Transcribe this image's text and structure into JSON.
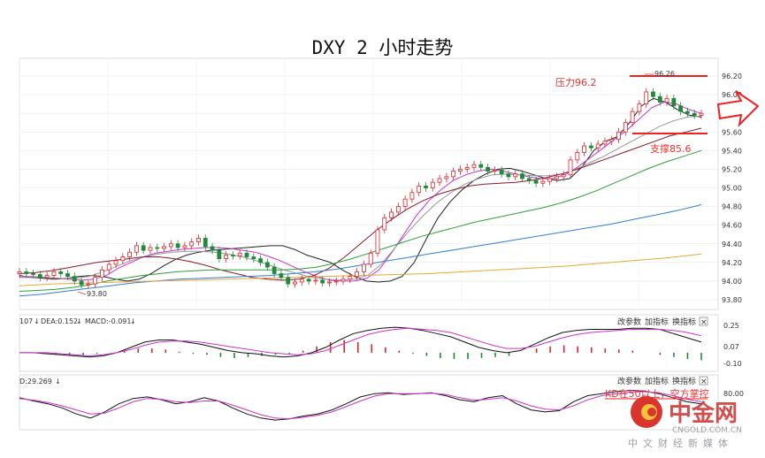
{
  "page": {
    "title": "DXY 2 小时走势"
  },
  "chart_data": [
    {
      "type": "candlestick",
      "title": "DXY 2 小时走势",
      "ylim": [
        93.8,
        96.2
      ],
      "yticks": [
        93.8,
        94.0,
        94.2,
        94.4,
        94.6,
        94.8,
        95.0,
        95.2,
        95.4,
        95.6,
        95.8,
        96.0,
        96.2
      ],
      "ytick_labels": [
        "93.80",
        "94.00",
        "94.20",
        "94.40",
        "94.60",
        "94.80",
        "95.00",
        "95.20",
        "95.40",
        "95.60",
        "95.80",
        "96.00",
        "96.20"
      ],
      "grid": true,
      "closes": [
        94.1,
        94.08,
        94.07,
        94.04,
        94.06,
        94.1,
        94.08,
        94.05,
        94.0,
        93.96,
        93.97,
        94.04,
        94.12,
        94.18,
        94.22,
        94.26,
        94.31,
        94.38,
        94.33,
        94.36,
        94.35,
        94.37,
        94.4,
        94.36,
        94.38,
        94.42,
        94.46,
        94.37,
        94.33,
        94.24,
        94.28,
        94.27,
        94.3,
        94.26,
        94.24,
        94.2,
        94.15,
        94.08,
        94.04,
        93.97,
        93.99,
        94.02,
        94.0,
        94.01,
        93.98,
        93.99,
        94.0,
        94.02,
        94.05,
        94.1,
        94.18,
        94.3,
        94.55,
        94.68,
        94.74,
        94.8,
        94.88,
        94.95,
        95.02,
        95.0,
        95.06,
        95.1,
        95.12,
        95.18,
        95.2,
        95.22,
        95.25,
        95.22,
        95.18,
        95.19,
        95.15,
        95.12,
        95.15,
        95.1,
        95.08,
        95.05,
        95.07,
        95.1,
        95.12,
        95.14,
        95.3,
        95.38,
        95.45,
        95.43,
        95.47,
        95.5,
        95.52,
        95.6,
        95.7,
        95.82,
        95.9,
        96.03,
        95.98,
        95.92,
        95.96,
        95.88,
        95.82,
        95.8,
        95.78,
        95.8
      ],
      "price_annotations": [
        {
          "label": "93.80",
          "value": 93.8
        },
        {
          "label": "96.26",
          "value": 96.26
        }
      ],
      "moving_averages": [
        {
          "color": "#222222",
          "values": [
            94.06,
            94.04,
            94.03,
            94.02,
            94.03,
            94.05,
            94.06,
            94.05,
            94.02,
            94.0,
            94.02,
            94.08,
            94.16,
            94.23,
            94.28,
            94.31,
            94.33,
            94.34,
            94.35,
            94.36,
            94.37,
            94.38,
            94.38,
            94.34,
            94.28,
            94.24,
            94.2,
            94.12,
            94.05,
            94.0,
            93.99,
            94.0,
            94.05,
            94.2,
            94.45,
            94.68,
            94.85,
            94.98,
            95.08,
            95.15,
            95.2,
            95.21,
            95.18,
            95.14,
            95.1,
            95.08,
            95.1,
            95.22,
            95.4,
            95.5,
            95.55,
            95.7,
            95.88,
            95.96,
            95.92,
            95.84,
            95.78,
            95.76
          ]
        },
        {
          "color": "#cc33cc",
          "values": [
            94.04,
            94.04,
            94.04,
            94.03,
            94.02,
            94.01,
            94.02,
            94.06,
            94.14,
            94.2,
            94.26,
            94.3,
            94.32,
            94.34,
            94.35,
            94.36,
            94.36,
            94.35,
            94.33,
            94.31,
            94.27,
            94.22,
            94.16,
            94.1,
            94.05,
            94.01,
            94.0,
            94.0,
            94.03,
            94.12,
            94.3,
            94.5,
            94.7,
            94.86,
            94.98,
            95.08,
            95.14,
            95.18,
            95.2,
            95.18,
            95.15,
            95.12,
            95.1,
            95.1,
            95.14,
            95.22,
            95.32,
            95.42,
            95.52,
            95.62,
            95.74,
            95.86,
            95.92,
            95.9,
            95.84,
            95.8
          ]
        },
        {
          "color": "#999999",
          "values": [
            94.05,
            94.05,
            94.04,
            94.03,
            94.03,
            94.05,
            94.1,
            94.16,
            94.22,
            94.26,
            94.29,
            94.31,
            94.32,
            94.32,
            94.31,
            94.29,
            94.26,
            94.22,
            94.17,
            94.12,
            94.08,
            94.04,
            94.02,
            94.01,
            94.02,
            94.06,
            94.18,
            94.36,
            94.54,
            94.7,
            94.84,
            94.95,
            95.04,
            95.1,
            95.14,
            95.15,
            95.14,
            95.13,
            95.13,
            95.15,
            95.2,
            95.27,
            95.34,
            95.42,
            95.5,
            95.58,
            95.66,
            95.72,
            95.76,
            95.77
          ]
        },
        {
          "color": "#8b1a2b",
          "values": [
            94.08,
            94.09,
            94.11,
            94.14,
            94.17,
            94.2,
            94.22,
            94.24,
            94.26,
            94.26,
            94.24,
            94.21,
            94.17,
            94.12,
            94.08,
            94.04,
            94.02,
            94.01,
            94.02,
            94.06,
            94.14,
            94.26,
            94.4,
            94.54,
            94.66,
            94.77,
            94.86,
            94.93,
            94.98,
            95.02,
            95.04,
            95.05,
            95.06,
            95.08,
            95.11,
            95.15,
            95.2,
            95.26,
            95.32,
            95.38,
            95.44,
            95.5,
            95.56,
            95.6,
            95.64
          ]
        },
        {
          "color": "#2e9e3e",
          "values": [
            93.89,
            93.9,
            93.91,
            93.93,
            93.96,
            94.0,
            94.03,
            94.06,
            94.08,
            94.1,
            94.11,
            94.12,
            94.12,
            94.12,
            94.12,
            94.12,
            94.13,
            94.15,
            94.19,
            94.24,
            94.3,
            94.36,
            94.42,
            94.48,
            94.53,
            94.58,
            94.63,
            94.67,
            94.71,
            94.75,
            94.79,
            94.84,
            94.9,
            94.97,
            95.05,
            95.13,
            95.21,
            95.28,
            95.34,
            95.4
          ]
        },
        {
          "color": "#2f7fd8",
          "values": [
            93.84,
            93.86,
            93.89,
            93.92,
            93.95,
            93.98,
            94.0,
            94.02,
            94.03,
            94.04,
            94.05,
            94.06,
            94.08,
            94.1,
            94.13,
            94.17,
            94.21,
            94.25,
            94.29,
            94.33,
            94.37,
            94.41,
            94.45,
            94.49,
            94.53,
            94.57,
            94.61,
            94.66,
            94.71,
            94.76,
            94.82
          ]
        },
        {
          "color": "#e8a63a",
          "values": [
            93.95,
            93.97,
            93.98,
            93.99,
            94.0,
            94.01,
            94.02,
            94.03,
            94.04,
            94.05,
            94.06,
            94.07,
            94.08,
            94.1,
            94.12,
            94.14,
            94.16,
            94.19,
            94.22,
            94.25,
            94.29
          ]
        }
      ]
    },
    {
      "type": "line",
      "title": "MACD",
      "header_values": [
        "107",
        "DEA:0.152",
        "MACD:-0.091"
      ],
      "ylim": [
        -0.1,
        0.25
      ],
      "yticks": [
        0.25,
        0.07,
        -0.1
      ],
      "ytick_labels": [
        "0.25",
        "0.07",
        "-0.10"
      ],
      "series": [
        {
          "color": "#111111",
          "values": [
            0.0,
            0.0,
            -0.01,
            -0.02,
            -0.03,
            -0.04,
            -0.03,
            0.0,
            0.05,
            0.1,
            0.12,
            0.12,
            0.1,
            0.08,
            0.05,
            0.02,
            0.0,
            -0.01,
            -0.03,
            -0.04,
            -0.03,
            0.0,
            0.05,
            0.12,
            0.18,
            0.21,
            0.23,
            0.24,
            0.23,
            0.21,
            0.18,
            0.15,
            0.1,
            0.05,
            0.02,
            0.0,
            0.02,
            0.08,
            0.14,
            0.19,
            0.21,
            0.22,
            0.22,
            0.22,
            0.23,
            0.23,
            0.22,
            0.18,
            0.14,
            0.1
          ]
        },
        {
          "color": "#cc33cc",
          "values": [
            0.0,
            0.0,
            0.0,
            -0.01,
            -0.02,
            -0.03,
            -0.02,
            0.0,
            0.03,
            0.07,
            0.1,
            0.11,
            0.11,
            0.1,
            0.08,
            0.06,
            0.04,
            0.02,
            0.0,
            -0.01,
            -0.02,
            -0.01,
            0.02,
            0.07,
            0.12,
            0.17,
            0.2,
            0.22,
            0.23,
            0.22,
            0.21,
            0.19,
            0.15,
            0.11,
            0.07,
            0.04,
            0.04,
            0.06,
            0.1,
            0.14,
            0.17,
            0.19,
            0.2,
            0.21,
            0.22,
            0.22,
            0.22,
            0.21,
            0.19,
            0.16
          ]
        }
      ],
      "histogram": [
        0.0,
        -0.01,
        -0.02,
        -0.02,
        -0.02,
        -0.01,
        0.0,
        0.02,
        0.04,
        0.04,
        0.03,
        0.01,
        -0.01,
        -0.02,
        -0.04,
        -0.05,
        -0.04,
        -0.03,
        -0.02,
        -0.01,
        0.02,
        0.06,
        0.1,
        0.12,
        0.1,
        0.08,
        0.05,
        0.02,
        -0.01,
        -0.03,
        -0.05,
        -0.06,
        -0.06,
        -0.05,
        -0.04,
        -0.03,
        0.0,
        0.04,
        0.06,
        0.07,
        0.06,
        0.05,
        0.04,
        0.03,
        0.02,
        0.0,
        -0.02,
        -0.04,
        -0.06,
        -0.07
      ]
    },
    {
      "type": "line",
      "title": "KD",
      "header_values": [
        "D:29.269"
      ],
      "ylim": [
        0,
        100
      ],
      "yticks": [
        80.0
      ],
      "ytick_labels": [
        "80.00"
      ],
      "series": [
        {
          "color": "#111111",
          "values": [
            70,
            62,
            55,
            45,
            30,
            20,
            35,
            55,
            68,
            72,
            65,
            55,
            60,
            70,
            62,
            45,
            30,
            20,
            15,
            18,
            25,
            30,
            40,
            55,
            72,
            80,
            82,
            78,
            80,
            82,
            75,
            65,
            60,
            70,
            75,
            55,
            40,
            35,
            38,
            60,
            75,
            80,
            85,
            88,
            86,
            80,
            70,
            60,
            55
          ]
        },
        {
          "color": "#cc33cc",
          "values": [
            68,
            64,
            58,
            50,
            40,
            30,
            32,
            45,
            60,
            68,
            66,
            60,
            58,
            62,
            62,
            52,
            40,
            28,
            20,
            18,
            22,
            27,
            35,
            48,
            62,
            74,
            80,
            80,
            80,
            81,
            78,
            70,
            64,
            66,
            70,
            62,
            50,
            42,
            40,
            50,
            65,
            75,
            80,
            84,
            85,
            82,
            75,
            66,
            60
          ]
        }
      ]
    }
  ],
  "panels": {
    "macd": {
      "header_1": "107",
      "header_2": "DEA:0.152",
      "header_3": "MACD:-0.091",
      "btn_params": "改参数",
      "btn_add": "加指标",
      "btn_switch": "换指标",
      "btn_close": "×"
    },
    "kd": {
      "header_1": "D:29.269",
      "btn_params": "改参数",
      "btn_add": "加指标",
      "btn_switch": "换指标",
      "btn_close": "×"
    }
  },
  "annotations": {
    "resistance": "压力96.2",
    "support": "支撑85.6",
    "kd_note": "KD在50以上，空方掌控",
    "low_label": "93.80",
    "high_label": "96.26"
  },
  "watermark": {
    "brand": "中金网",
    "url": "CNGOLD.COM.CN",
    "tagline": "中文财经新媒体"
  },
  "colors": {
    "up": "#d6262b",
    "down": "#1f8a3a",
    "annotation": "#ee2222",
    "grid": "#e6e6e6"
  }
}
